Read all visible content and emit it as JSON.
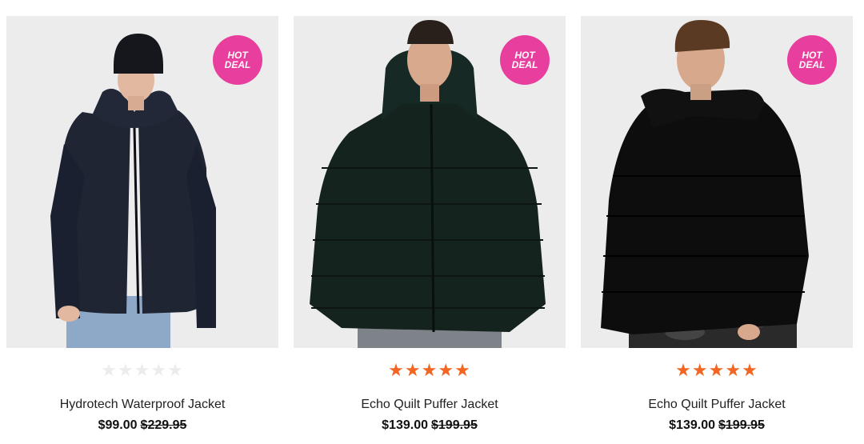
{
  "products": [
    {
      "badge": [
        "HOT",
        "DEAL"
      ],
      "rating": 0,
      "name": "Hydrotech Waterproof Jacket",
      "price": "$99.00",
      "was_price": "$229.95",
      "image_icon": "model-wearing-navy-shell-jacket-and-beanie"
    },
    {
      "badge": [
        "HOT",
        "DEAL"
      ],
      "rating": 5,
      "name": "Echo Quilt Puffer Jacket",
      "price": "$139.00",
      "was_price": "$199.95",
      "image_icon": "model-wearing-dark-green-puffer-jacket"
    },
    {
      "badge": [
        "HOT",
        "DEAL"
      ],
      "rating": 5,
      "name": "Echo Quilt Puffer Jacket",
      "price": "$139.00",
      "was_price": "$199.95",
      "image_icon": "model-wearing-black-puffer-jacket"
    }
  ],
  "colors": {
    "badge": "#e83e9e",
    "star_filled": "#f26522",
    "star_empty": "#ececec",
    "image_background": "#ededed"
  }
}
